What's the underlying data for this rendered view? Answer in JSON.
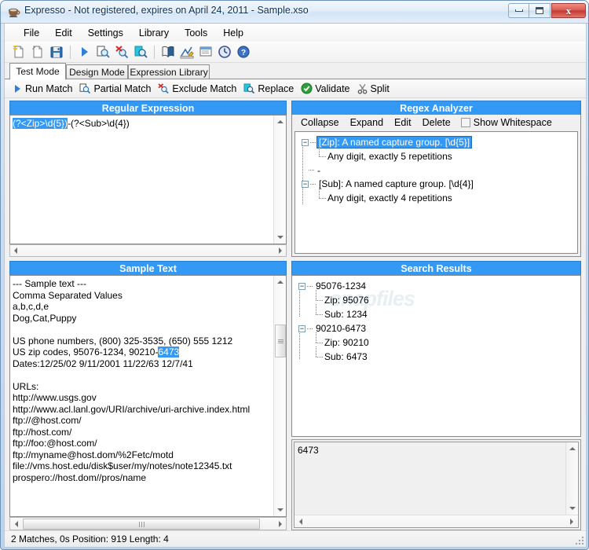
{
  "window": {
    "title": "Expresso - Not registered, expires on April 24, 2011 - Sample.xso",
    "icon": "coffee-cup-icon",
    "minimize": "–",
    "maximize": "□",
    "close": "x"
  },
  "menu": {
    "items": [
      {
        "label": "File"
      },
      {
        "label": "Edit"
      },
      {
        "label": "Settings"
      },
      {
        "label": "Library"
      },
      {
        "label": "Tools"
      },
      {
        "label": "Help"
      }
    ]
  },
  "toolbar": {
    "buttons": [
      {
        "name": "new-document-icon"
      },
      {
        "name": "open-document-icon"
      },
      {
        "name": "save-icon"
      },
      {
        "name": "separator"
      },
      {
        "name": "run-match-icon"
      },
      {
        "name": "partial-match-icon"
      },
      {
        "name": "exclude-match-icon"
      },
      {
        "name": "replace-icon"
      },
      {
        "name": "separator"
      },
      {
        "name": "library-book-icon"
      },
      {
        "name": "design-mode-icon"
      },
      {
        "name": "notes-icon"
      },
      {
        "name": "history-clock-icon"
      },
      {
        "name": "help-icon"
      }
    ]
  },
  "tabs": [
    {
      "label": "Test Mode",
      "active": true
    },
    {
      "label": "Design Mode",
      "active": false
    },
    {
      "label": "Expression Library",
      "active": false
    }
  ],
  "actions": [
    {
      "label": "Run Match",
      "icon": "play-triangle-icon"
    },
    {
      "label": "Partial Match",
      "icon": "partial-match-icon"
    },
    {
      "label": "Exclude Match",
      "icon": "exclude-match-icon"
    },
    {
      "label": "Replace",
      "icon": "replace-icon"
    },
    {
      "label": "Validate",
      "icon": "green-check-icon"
    },
    {
      "label": "Split",
      "icon": "scissors-icon"
    }
  ],
  "regex_panel": {
    "title": "Regular Expression",
    "selected_text": "(?<Zip>\\d{5})",
    "rest_text": "-(?<Sub>\\d{4})"
  },
  "analyzer_panel": {
    "title": "Regex Analyzer",
    "toolbar": {
      "collapse": "Collapse",
      "expand": "Expand",
      "edit": "Edit",
      "delete": "Delete",
      "show_whitespace": "Show Whitespace",
      "show_whitespace_checked": false
    },
    "tree": [
      {
        "label": "[Zip]: A named capture group. [\\d{5}]",
        "selected": true,
        "children": [
          {
            "label": "Any digit, exactly 5 repetitions"
          }
        ]
      },
      {
        "label": "-",
        "literal": true,
        "children": []
      },
      {
        "label": "[Sub]: A named capture group. [\\d{4}]",
        "selected": false,
        "children": [
          {
            "label": "Any digit, exactly 4 repetitions"
          }
        ]
      }
    ]
  },
  "sample_panel": {
    "title": "Sample Text",
    "lines_before": "--- Sample text ---\nComma Separated Values\na,b,c,d,e\nDog,Cat,Puppy\n\nUS phone numbers, (800) 325-3535, (650) 555 1212\nUS zip codes, 95076-1234, 90210-",
    "highlight": "6473",
    "lines_after": "\nDates:12/25/02 9/11/2001 11/22/63 12/7/41\n\nURLs:\nhttp://www.usgs.gov\nhttp://www.acl.lanl.gov/URI/archive/uri-archive.index.html\nftp://@host.com/\nftp://host.com/\nftp://foo:@host.com/\nftp://myname@host.dom/%2Fetc/motd\nfile://vms.host.edu/disk$user/my/notes/note12345.txt\nprospero://host.dom//pros/name"
  },
  "results_panel": {
    "title": "Search Results",
    "watermark": "snapfiles",
    "tree": [
      {
        "label": "95076-1234",
        "children": [
          {
            "label": "Zip: 95076"
          },
          {
            "label": "Sub: 1234"
          }
        ]
      },
      {
        "label": "90210-6473",
        "children": [
          {
            "label": "Zip: 90210"
          },
          {
            "label": "Sub: 6473"
          }
        ]
      }
    ]
  },
  "detail_panel": {
    "value": "6473"
  },
  "statusbar": {
    "text": "2 Matches, 0s  Position: 919  Length: 4"
  },
  "colors": {
    "panel_header": "#3399f5",
    "selection": "#3399f5",
    "close_button": "#c33a31"
  }
}
